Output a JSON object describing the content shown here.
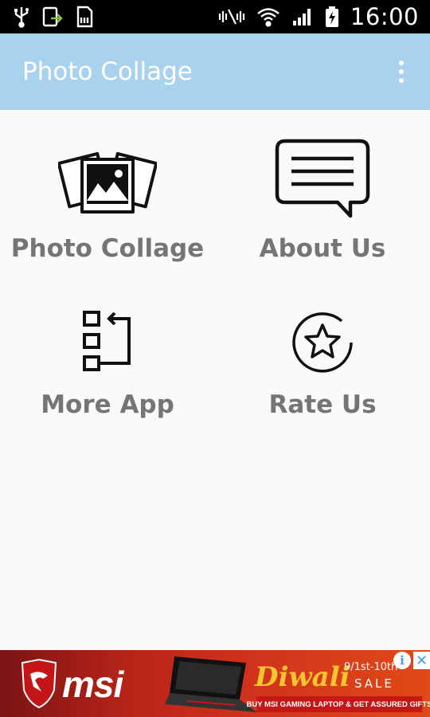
{
  "status_bar": {
    "time": "16:00",
    "left_icons": [
      "usb-icon",
      "screen-share-icon",
      "sd-card-icon"
    ],
    "right_icons": [
      "mute-icon",
      "wifi-icon",
      "signal-icon",
      "battery-charging-icon"
    ]
  },
  "app_bar": {
    "title": "Photo Collage",
    "menu_icon": "overflow-menu-icon",
    "background": "#a9d2ee"
  },
  "menu": {
    "items": [
      {
        "label": "Photo Collage",
        "icon": "photo-collage-icon"
      },
      {
        "label": "About Us",
        "icon": "chat-bubble-icon"
      },
      {
        "label": "More App",
        "icon": "more-apps-icon"
      },
      {
        "label": "Rate Us",
        "icon": "star-icon"
      }
    ],
    "label_color": "#757575"
  },
  "ad": {
    "brand": "msi",
    "headline": "Diwali",
    "dates": "9/1st-10th",
    "sale": "SALE",
    "tagline": "BUY MSI GAMING LAPTOP & GET ASSURED GIFTS",
    "info_icon": "info-icon",
    "close_icon": "close-icon"
  }
}
